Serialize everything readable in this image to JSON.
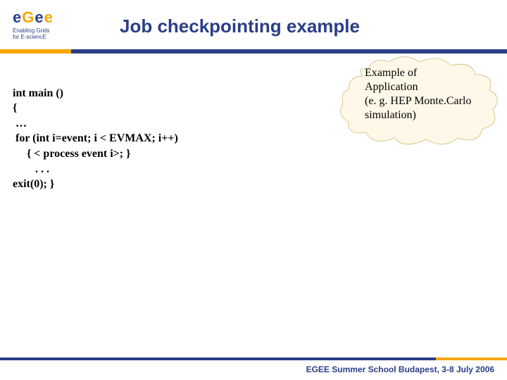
{
  "logo": {
    "brand_letters": [
      "e",
      "G",
      "e",
      "e"
    ],
    "subtitle_line1": "Enabling Grids",
    "subtitle_line2": "for E-sciencE"
  },
  "title": "Job checkpointing example",
  "code": {
    "line1": "int main ()",
    "line2": "{",
    "line3": " …",
    "line4": " for (int i=event; i < EVMAX; i++)",
    "line5": "     { < process event i>; }",
    "line6": "        . . .",
    "line7": "exit(0); }"
  },
  "callout": {
    "line1": "Example of",
    "line2": "Application",
    "line3": "(e. g. HEP Monte.Carlo",
    "line4": "simulation)"
  },
  "footer": "EGEE Summer School Budapest, 3-8 July 2006"
}
